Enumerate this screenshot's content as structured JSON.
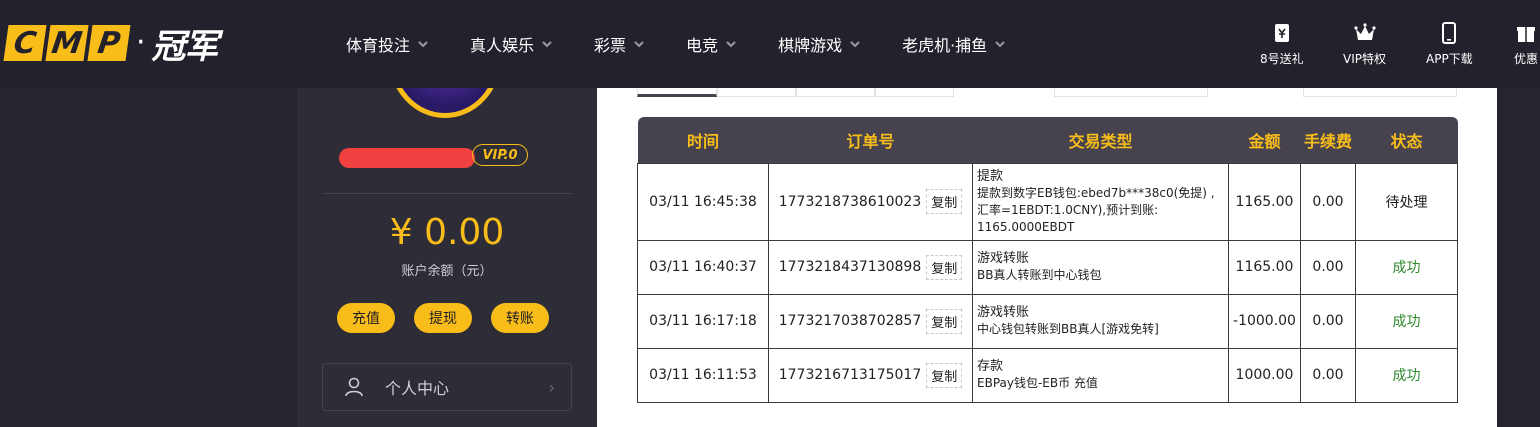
{
  "brand": {
    "logo_letters": [
      "C",
      "M",
      "P"
    ],
    "logo_dot": "·",
    "logo_cn": "冠军"
  },
  "nav": [
    {
      "label": "体育投注"
    },
    {
      "label": "真人娱乐"
    },
    {
      "label": "彩票"
    },
    {
      "label": "电竞"
    },
    {
      "label": "棋牌游戏"
    },
    {
      "label": "老虎机·捕鱼"
    }
  ],
  "quick_links": [
    {
      "label": "8号送礼",
      "icon": "ticket-icon"
    },
    {
      "label": "VIP特权",
      "icon": "crown-icon"
    },
    {
      "label": "APP下载",
      "icon": "phone-icon"
    },
    {
      "label": "优惠",
      "icon": "gift-icon"
    }
  ],
  "sidebar": {
    "vip_label": "VIP.0",
    "balance": "¥ 0.00",
    "balance_label": "账户余额（元）",
    "buttons": {
      "deposit": "充值",
      "withdraw": "提现",
      "transfer": "转账"
    },
    "personal_center": "个人中心"
  },
  "table": {
    "headers": {
      "time": "时间",
      "order": "订单号",
      "type": "交易类型",
      "amount": "金额",
      "fee": "手续费",
      "status": "状态"
    },
    "copy_label": "复制",
    "rows": [
      {
        "time": "03/11 16:45:38",
        "order": "1773218738610023",
        "type_title": "提款",
        "type_detail": "提款到数字EB钱包:ebed7b***38c0(免提) ,汇率=1EBDT:1.0CNY),预计到账: 1165.0000EBDT",
        "amount": "1165.00",
        "fee": "0.00",
        "status": "待处理",
        "status_kind": "pending"
      },
      {
        "time": "03/11 16:40:37",
        "order": "1773218437130898",
        "type_title": "游戏转账",
        "type_detail": "BB真人转账到中心钱包",
        "amount": "1165.00",
        "fee": "0.00",
        "status": "成功",
        "status_kind": "success"
      },
      {
        "time": "03/11 16:17:18",
        "order": "1773217038702857",
        "type_title": "游戏转账",
        "type_detail": "中心钱包转账到BB真人[游戏免转]",
        "amount": "-1000.00",
        "fee": "0.00",
        "status": "成功",
        "status_kind": "success"
      },
      {
        "time": "03/11 16:11:53",
        "order": "1773216713175017",
        "type_title": "存款",
        "type_detail": "EBPay钱包-EB币 充值",
        "amount": "1000.00",
        "fee": "0.00",
        "status": "成功",
        "status_kind": "success"
      }
    ]
  },
  "colors": {
    "accent": "#f9bd1a",
    "topbar_bg": "#23212b",
    "sidebar_bg": "#2e2c37",
    "table_header_bg": "#46434f",
    "success": "#2f8a2f",
    "username_mask": "#f04140"
  }
}
